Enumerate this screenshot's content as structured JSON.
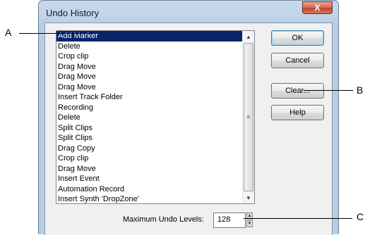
{
  "window": {
    "title": "Undo History",
    "close_label": "X"
  },
  "history_list": {
    "items": [
      "Add Marker",
      "Delete",
      "Crop clip",
      "Drag Move",
      "Drag Move",
      "Drag Move",
      "Insert Track Folder",
      "Recording",
      "Delete",
      "Split Clips",
      "Split Clips",
      "Drag Copy",
      "Crop clip",
      "Drag Move",
      "Insert Event",
      "Automation Record",
      "Insert Synth 'DropZone'"
    ],
    "selected_index": 0,
    "scroll_up": "▲",
    "scroll_down": "▼",
    "scroll_grip": "≡"
  },
  "buttons": {
    "ok": "OK",
    "cancel": "Cancel",
    "clear": "Clear...",
    "help": "Help"
  },
  "undo_levels": {
    "label": "Maximum Undo Levels:",
    "value": "128",
    "spin_up": "▲",
    "spin_down": "▼"
  },
  "callouts": {
    "a": "A",
    "b": "B",
    "c": "C"
  }
}
